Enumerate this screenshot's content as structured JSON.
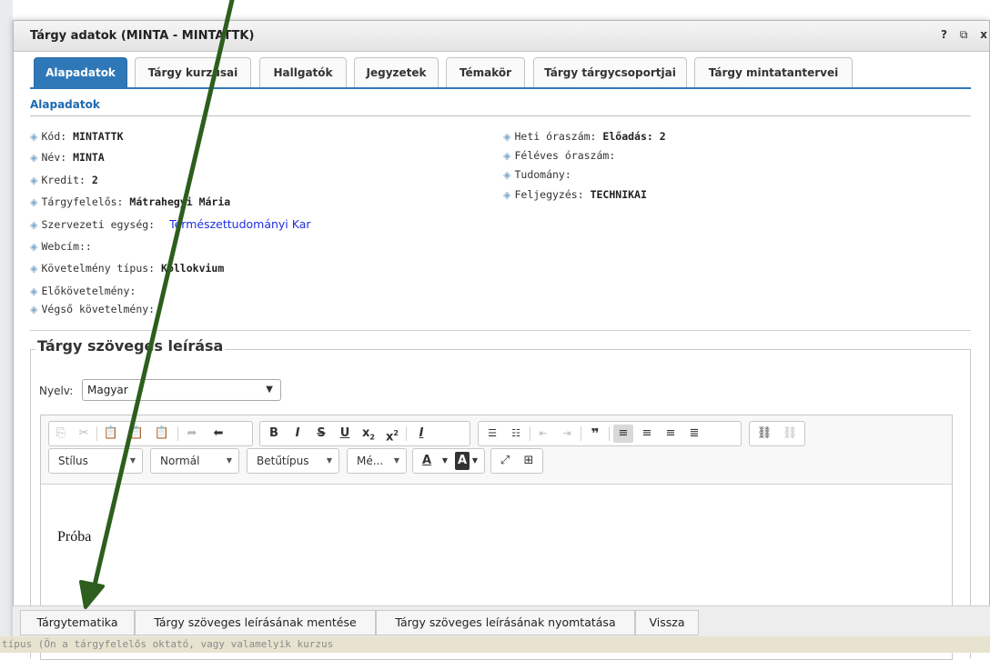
{
  "background": {
    "bottom_text": "típus (Ön a tárgyfelelős oktató, vagy valamelyik kurzus"
  },
  "dialog": {
    "title": "Tárgy adatok (MINTA - MINTATTK)",
    "title_icons": {
      "help": "?",
      "popout": "⧉",
      "close": "x"
    }
  },
  "tabs": [
    {
      "label": "Alapadatok",
      "active": true
    },
    {
      "label": "Tárgy kurzusai"
    },
    {
      "label": "Hallgatók"
    },
    {
      "label": "Jegyzetek"
    },
    {
      "label": "Témakör"
    },
    {
      "label": "Tárgy tárgycsoportjai"
    },
    {
      "label": "Tárgy mintatantervei"
    }
  ],
  "section_title": "Alapadatok",
  "details_left": [
    {
      "label": "Kód:",
      "value": "MINTATTK"
    },
    {
      "label": "Név:",
      "value": "MINTA"
    },
    {
      "label": "Kredit:",
      "value": "2"
    },
    {
      "label": "Tárgyfelelős:",
      "value": "Mátrahegyi Mária"
    },
    {
      "label": "Szervezeti egység:",
      "link": "Természettudományi Kar"
    },
    {
      "label": "Webcím::",
      "value": ""
    },
    {
      "label": "Követelmény típus:",
      "value": "Kollokvium"
    },
    {
      "label": "Előkövetelmény:",
      "value": ""
    },
    {
      "label": "Végső követelmény:",
      "value": ""
    }
  ],
  "details_right": [
    {
      "label": "Heti óraszám:",
      "value": "Előadás: 2"
    },
    {
      "label": "Féléves óraszám:",
      "value": ""
    },
    {
      "label": "Tudomány:",
      "value": ""
    },
    {
      "label": "Feljegyzés:",
      "value": "TECHNIKAI"
    }
  ],
  "description": {
    "legend": "Tárgy szöveges leírása",
    "language_label": "Nyelv:",
    "language_value": "Magyar",
    "combos": {
      "style": "Stílus",
      "format": "Normál",
      "font": "Betűtípus",
      "size": "Mé..."
    },
    "content": "Próba"
  },
  "footer_buttons": [
    "Tárgytematika",
    "Tárgy szöveges leírásának mentése",
    "Tárgy szöveges leírásának nyomtatása",
    "Vissza"
  ],
  "colors": {
    "accent": "#2f78b8",
    "arrow": "#2e5e1e",
    "link": "#1f2fe0"
  }
}
